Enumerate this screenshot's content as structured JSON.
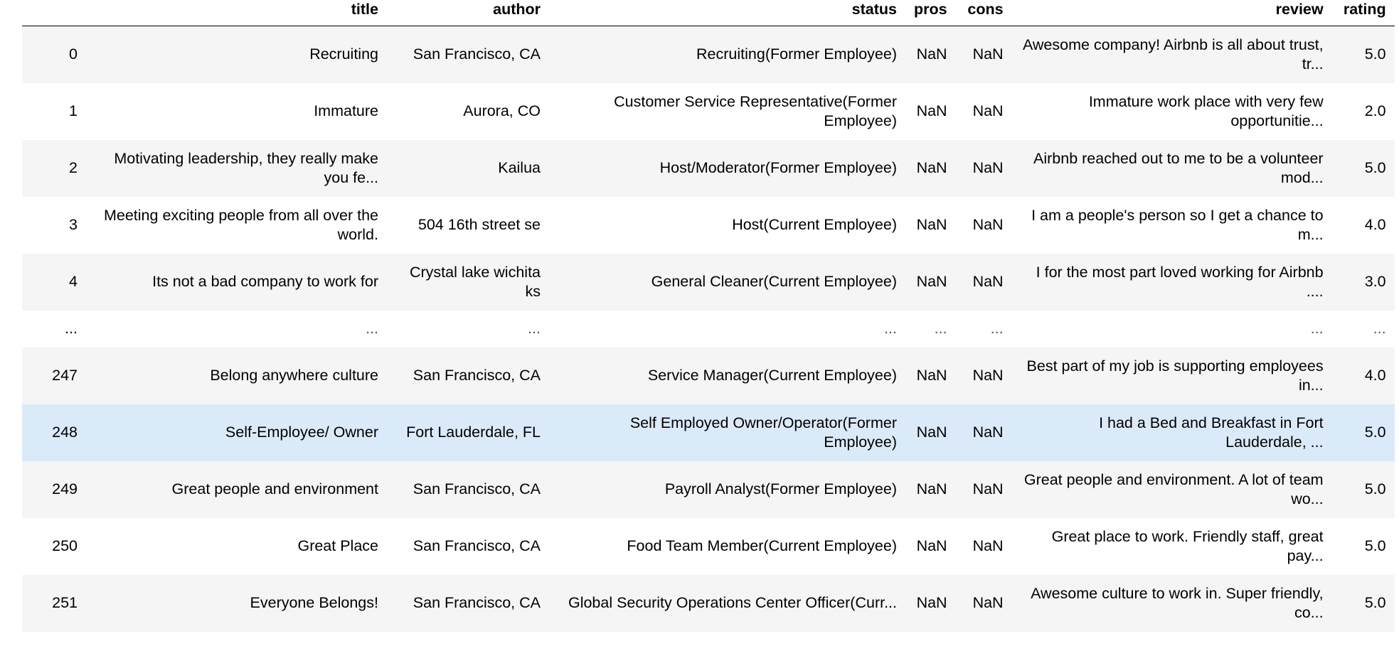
{
  "columns": {
    "index": "",
    "title": "title",
    "author": "author",
    "status": "status",
    "pros": "pros",
    "cons": "cons",
    "review": "review",
    "rating": "rating"
  },
  "rows": [
    {
      "index": "0",
      "title": "Recruiting",
      "author": "San Francisco, CA",
      "status": "Recruiting(Former Employee)",
      "pros": "NaN",
      "cons": "NaN",
      "review": "Awesome company! Airbnb is all about trust, tr...",
      "rating": "5.0"
    },
    {
      "index": "1",
      "title": "Immature",
      "author": "Aurora, CO",
      "status": "Customer Service Representative(Former Employee)",
      "pros": "NaN",
      "cons": "NaN",
      "review": "Immature work place with very few opportunitie...",
      "rating": "2.0"
    },
    {
      "index": "2",
      "title": "Motivating leadership, they really make you fe...",
      "author": "Kailua",
      "status": "Host/Moderator(Former Employee)",
      "pros": "NaN",
      "cons": "NaN",
      "review": "Airbnb reached out to me to be a volunteer mod...",
      "rating": "5.0"
    },
    {
      "index": "3",
      "title": "Meeting exciting people from all over the world.",
      "author": "504 16th street se",
      "status": "Host(Current Employee)",
      "pros": "NaN",
      "cons": "NaN",
      "review": "I am a people's person so I get a chance to m...",
      "rating": "4.0"
    },
    {
      "index": "4",
      "title": "Its not a bad company to work for",
      "author": "Crystal lake wichita ks",
      "status": "General Cleaner(Current Employee)",
      "pros": "NaN",
      "cons": "NaN",
      "review": "I for the most part loved working for Airbnb ....",
      "rating": "3.0"
    },
    {
      "index": "...",
      "title": "...",
      "author": "...",
      "status": "...",
      "pros": "...",
      "cons": "...",
      "review": "...",
      "rating": "..."
    },
    {
      "index": "247",
      "title": "Belong anywhere culture",
      "author": "San Francisco, CA",
      "status": "Service Manager(Current Employee)",
      "pros": "NaN",
      "cons": "NaN",
      "review": "Best part of my job is supporting employees in...",
      "rating": "4.0"
    },
    {
      "index": "248",
      "title": "Self-Employee/ Owner",
      "author": "Fort Lauderdale, FL",
      "status": "Self Employed Owner/Operator(Former Employee)",
      "pros": "NaN",
      "cons": "NaN",
      "review": "I had a Bed and Breakfast in Fort Lauderdale, ...",
      "rating": "5.0"
    },
    {
      "index": "249",
      "title": "Great people and environment",
      "author": "San Francisco, CA",
      "status": "Payroll Analyst(Former Employee)",
      "pros": "NaN",
      "cons": "NaN",
      "review": "Great people and environment. A lot of team wo...",
      "rating": "5.0"
    },
    {
      "index": "250",
      "title": "Great Place",
      "author": "San Francisco, CA",
      "status": "Food Team Member(Current Employee)",
      "pros": "NaN",
      "cons": "NaN",
      "review": "Great place to work. Friendly staff, great pay...",
      "rating": "5.0"
    },
    {
      "index": "251",
      "title": "Everyone Belongs!",
      "author": "San Francisco, CA",
      "status": "Global Security Operations Center Officer(Curr...",
      "pros": "NaN",
      "cons": "NaN",
      "review": "Awesome culture to work in. Super friendly, co...",
      "rating": "5.0"
    }
  ],
  "colors": {
    "row_odd": "#f5f5f5",
    "row_even": "#ffffff",
    "row_hover": "#dbeaf8"
  }
}
